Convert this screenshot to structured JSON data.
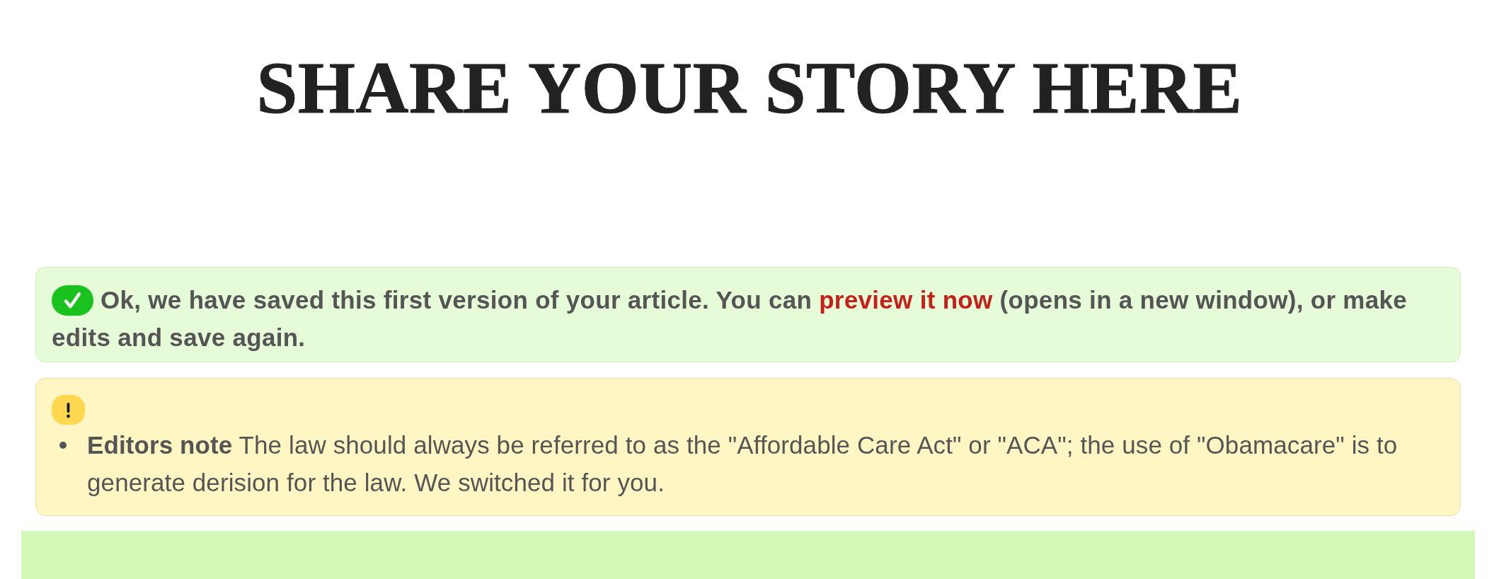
{
  "page_title": "SHARE YOUR STORY HERE",
  "alerts": [
    {
      "kind": "success",
      "text": "Ok, we have saved this first version of your article. You can ",
      "link": "preview it now",
      "text_after": " (opens in a new window), or make edits and save again."
    },
    {
      "kind": "warning",
      "notes": [
        "**Editors note** The law should always be referred to as the \"Affordable Care Act\" or \"ACA\"; the use of \"Obamacare\" is to generate derision for the law. We switched it for you."
      ]
    }
  ]
}
